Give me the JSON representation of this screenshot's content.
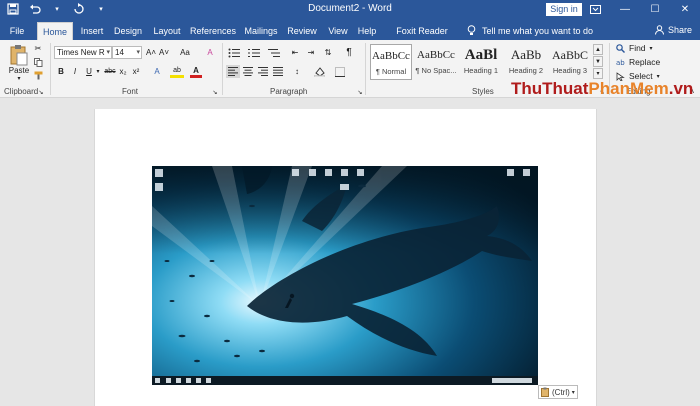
{
  "titlebar": {
    "doc_title": "Document2  -  Word",
    "signin": "Sign in",
    "minimize": "—",
    "restore": "☐",
    "close": "✕",
    "save_icon": "save-icon",
    "undo_icon": "undo-icon",
    "redo_icon": "redo-icon"
  },
  "tabs": [
    "File",
    "Home",
    "Insert",
    "Design",
    "Layout",
    "References",
    "Mailings",
    "Review",
    "View",
    "Help",
    "Foxit Reader PDF"
  ],
  "tell_me": "Tell me what you want to do",
  "share": "Share",
  "clipboard": {
    "paste": "Paste",
    "label": "Clipboard"
  },
  "font": {
    "name": "Times New R",
    "size": "14",
    "label": "Font",
    "bold": "B",
    "italic": "I",
    "underline": "U",
    "strike": "abc",
    "sub": "x₂",
    "sup": "x²",
    "grow": "A˄",
    "shrink": "A˅",
    "case": "Aa",
    "highlight": "ab",
    "color": "A"
  },
  "paragraph": {
    "label": "Paragraph",
    "pilcrow": "¶"
  },
  "styles": {
    "label": "Styles",
    "items": [
      {
        "preview": "AaBbCc",
        "name": "¶ Normal"
      },
      {
        "preview": "AaBbCc",
        "name": "¶ No Spac..."
      },
      {
        "preview": "AaBl",
        "name": "Heading 1"
      },
      {
        "preview": "AaBb",
        "name": "Heading 2"
      },
      {
        "preview": "AaBbC",
        "name": "Heading 3"
      }
    ]
  },
  "editing": {
    "find": "Find",
    "replace": "Replace",
    "select": "Select",
    "label": "Editing"
  },
  "watermark": {
    "part1": "ThuThuat",
    "part2": "PhanMem",
    "part3": ".vn"
  },
  "paste_options": "(Ctrl)",
  "colors": {
    "accent": "#2b579a",
    "ribbon": "#f3f3f3",
    "page_bg": "#e6e6e6"
  }
}
